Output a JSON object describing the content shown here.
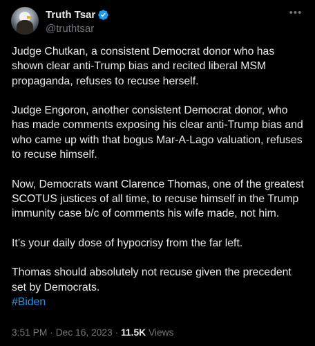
{
  "author": {
    "display_name": "Truth Tsar",
    "handle": "@truthtsar",
    "verified_badge_color": "#1d9bf0",
    "avatar_icon": "eagle-avatar"
  },
  "more_icon": "•••",
  "post": {
    "paragraphs": [
      "Judge Chutkan, a consistent Democrat donor who has shown clear anti-Trump bias and recited liberal MSM propaganda, refuses to recuse herself.",
      "Judge Engoron, another consistent Democrat donor, who has made comments exposing his clear anti-Trump bias and who came up with that bogus Mar-A-Lago valuation, refuses to recuse himself.",
      "Now, Democrats want Clarence Thomas, one of the greatest SCOTUS justices of all time, to recuse himself in the Trump immunity case b/c of comments his wife made, not him.",
      "It’s your daily dose of hypocrisy from the far left.",
      "Thomas should absolutely not recuse given the precedent set by Democrats."
    ],
    "hashtag": "#Biden"
  },
  "meta": {
    "time": "3:51 PM",
    "separator": "·",
    "date": "Dec 16, 2023",
    "views_count": "11.5K",
    "views_label": "Views"
  },
  "colors": {
    "background": "#000000",
    "text": "#e7e9ea",
    "secondary": "#71767b",
    "accent": "#1d9bf0"
  }
}
